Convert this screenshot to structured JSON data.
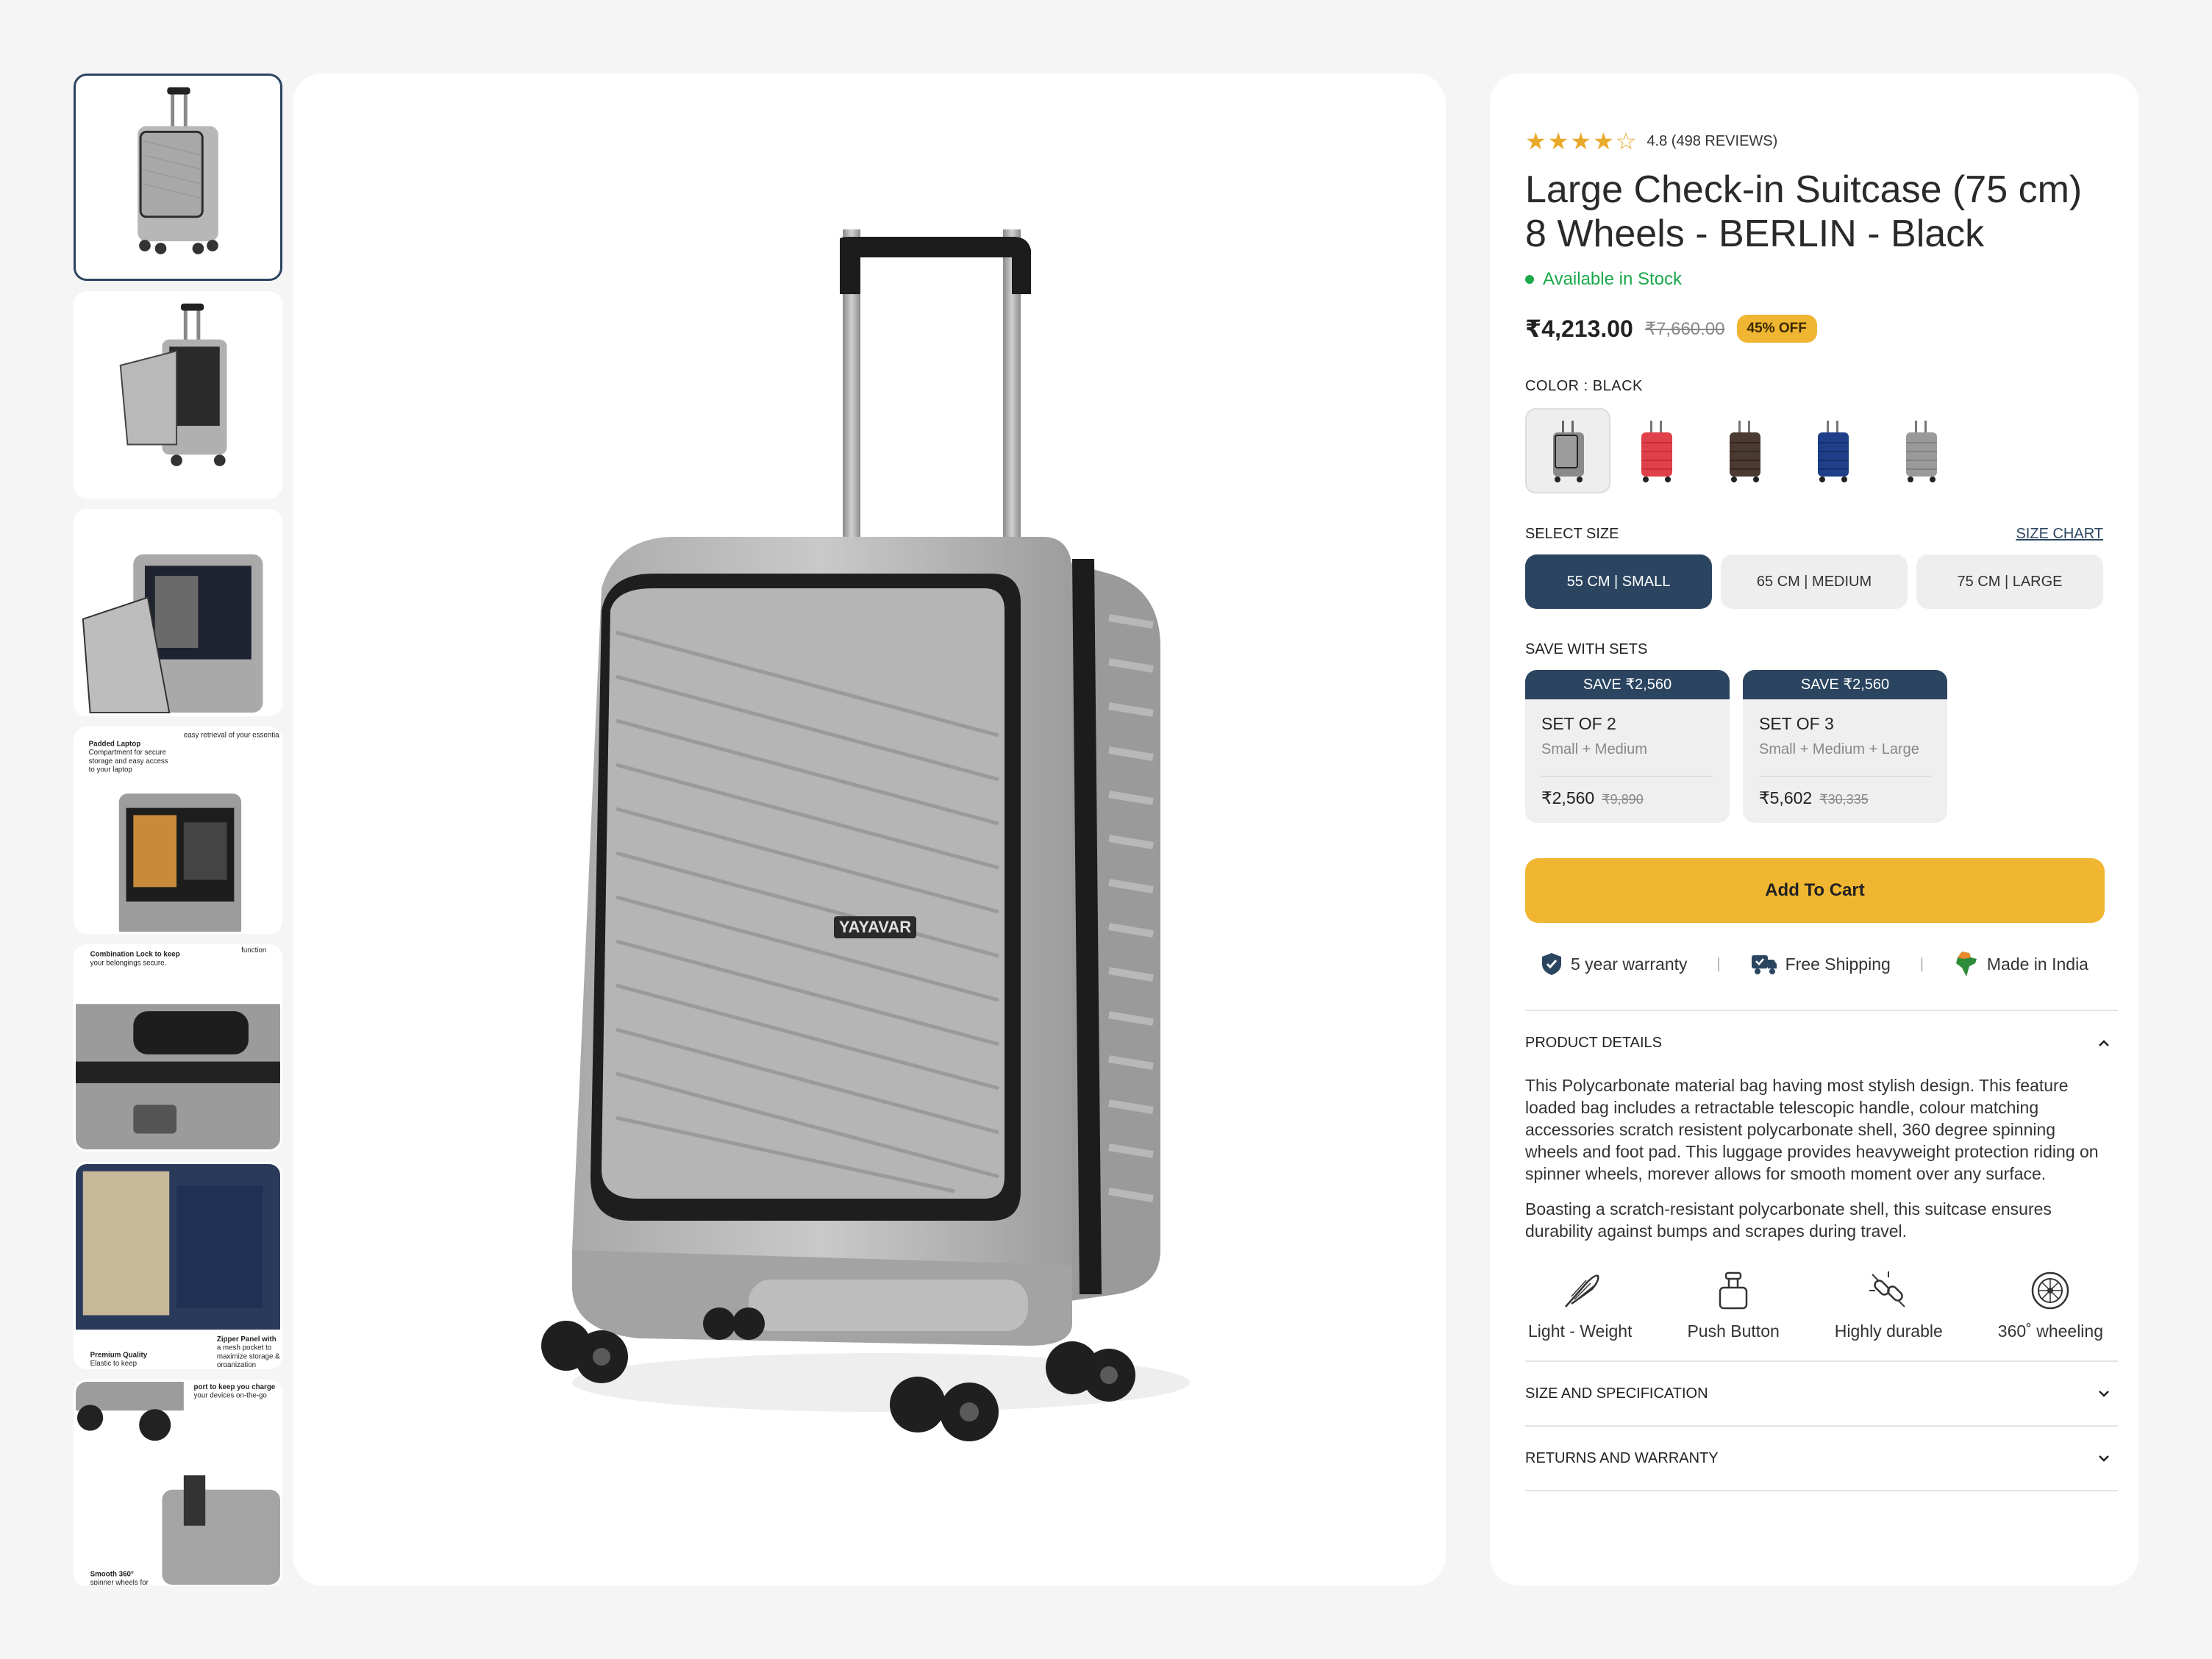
{
  "thumbnails": [
    {
      "name": "front-view",
      "active": true
    },
    {
      "name": "open-front-view",
      "active": false
    },
    {
      "name": "laptop-compartment-view",
      "active": false
    },
    {
      "name": "feature-callout-view",
      "active": false,
      "texts": [
        "Padded Laptop Compartment for secure storage and easy access to your laptop",
        "easy retrieval of your essentials"
      ]
    },
    {
      "name": "lock-view",
      "active": false,
      "texts": [
        "Combination Lock to keep your belongings secure.",
        "function"
      ]
    },
    {
      "name": "interior-view",
      "active": false,
      "texts": [
        "Premium Quality Elastic to keep",
        "Zipper Panel with a mesh pocket to maximize storage & organization"
      ]
    },
    {
      "name": "wheels-usb-view",
      "active": false,
      "texts": [
        "port to keep you charge your devices on-the-go",
        "Smooth 360° spinner wheels for"
      ]
    }
  ],
  "main_image": {
    "brand_label": "YAYAVAR"
  },
  "product": {
    "stars": "★★★★☆",
    "rating_text": "4.8 (498 REVIEWS)",
    "title": "Large Check-in Suitcase (75 cm) 8 Wheels - BERLIN - Black",
    "stock_text": "Available in Stock",
    "price": "₹4,213.00",
    "old_price": "₹7,660.00",
    "discount_badge": "45% OFF",
    "color_label": "COLOR :  BLACK",
    "colors": [
      {
        "name": "black-silver",
        "hex": "#6b6b6b",
        "active": true
      },
      {
        "name": "red",
        "hex": "#e0404a",
        "active": false
      },
      {
        "name": "brown",
        "hex": "#4a3a32",
        "active": false
      },
      {
        "name": "blue",
        "hex": "#1f3f8a",
        "active": false
      },
      {
        "name": "silver",
        "hex": "#9a9a9a",
        "active": false
      }
    ],
    "size_label": "SELECT SIZE",
    "size_chart_label": "SIZE CHART",
    "sizes": [
      {
        "label": "55 CM | SMALL",
        "active": true
      },
      {
        "label": "65 CM | MEDIUM",
        "active": false
      },
      {
        "label": "75 CM | LARGE",
        "active": false
      }
    ],
    "sets_label": "SAVE WITH SETS",
    "sets": [
      {
        "badge": "SAVE ₹2,560",
        "title": "SET OF 2",
        "sub": "Small + Medium",
        "price": "₹2,560",
        "old_price": "₹9,890"
      },
      {
        "badge": "SAVE ₹2,560",
        "title": "SET OF 3",
        "sub": "Small + Medium + Large",
        "price": "₹5,602",
        "old_price": "₹30,335"
      }
    ],
    "cart_label": "Add To Cart",
    "features": [
      {
        "label": "5 year warranty",
        "icon": "shield-check-icon"
      },
      {
        "label": "Free Shipping",
        "icon": "truck-icon"
      },
      {
        "label": "Made in India",
        "icon": "india-map-icon"
      }
    ],
    "separator": "|",
    "accordions": {
      "details_title": "PRODUCT DETAILS",
      "details_paragraphs": [
        "This Polycarbonate material bag having most stylish design. This feature loaded bag includes a retractable telescopic handle, colour matching accessories scratch resistent polycarbonate shell, 360 degree spinning wheels and foot pad. This luggage provides heavyweight protection riding on spinner wheels, morever allows for smooth moment over any surface.",
        "Boasting a scratch-resistant polycarbonate shell, this suitcase ensures durability against bumps and scrapes during travel."
      ],
      "spec_title": "SIZE AND SPECIFICATION",
      "returns_title": "RETURNS AND WARRANTY"
    },
    "highlight_icons": [
      {
        "label": "Light - Weight",
        "icon": "feather-icon"
      },
      {
        "label": "Push Button",
        "icon": "trolley-handle-icon"
      },
      {
        "label": "Highly durable",
        "icon": "durable-link-icon"
      },
      {
        "label": "360˚ wheeling",
        "icon": "wheel-icon"
      }
    ]
  },
  "colors": {
    "navy": "#2b4560",
    "accent": "#f0b531",
    "stock_green": "#1aa84a",
    "star": "#e9a92a"
  }
}
